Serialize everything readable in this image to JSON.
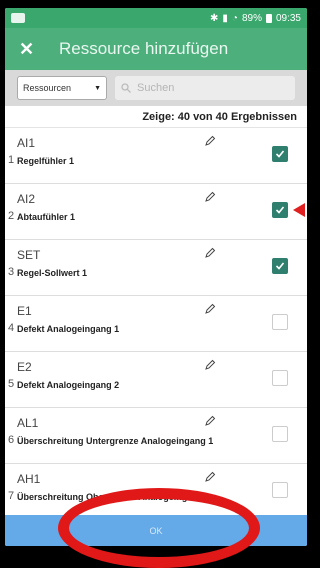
{
  "status_bar": {
    "icons": [
      "bluetooth-icon",
      "signal-icon",
      "wifi-icon"
    ],
    "battery": "89%",
    "time": "09:35"
  },
  "app_bar": {
    "close_icon": "close-icon",
    "title": "Ressource hinzufügen"
  },
  "filter": {
    "selected": "Ressourcen",
    "search_placeholder": "Suchen"
  },
  "results_text": "Zeige: 40 von 40 Ergebnissen",
  "items": [
    {
      "num": "1",
      "code": "AI1",
      "desc": "Regelfühler 1",
      "checked": true
    },
    {
      "num": "2",
      "code": "AI2",
      "desc": "Abtaufühler 1",
      "checked": true
    },
    {
      "num": "3",
      "code": "SET",
      "desc": "Regel-Sollwert 1",
      "checked": true
    },
    {
      "num": "4",
      "code": "E1",
      "desc": "Defekt Analogeingang 1",
      "checked": false
    },
    {
      "num": "5",
      "code": "E2",
      "desc": "Defekt Analogeingang 2",
      "checked": false
    },
    {
      "num": "6",
      "code": "AL1",
      "desc": "Überschreitung Untergrenze Analogeingang 1",
      "checked": false
    },
    {
      "num": "7",
      "code": "AH1",
      "desc": "Überschreitung Obergrenze Analogeingang 1",
      "checked": false
    }
  ],
  "ok_label": "OK",
  "colors": {
    "appbar": "#4caf7c",
    "checkbox_checked": "#2f7f6e",
    "ok_bar": "#64a9e8",
    "annotation": "#e01818"
  }
}
